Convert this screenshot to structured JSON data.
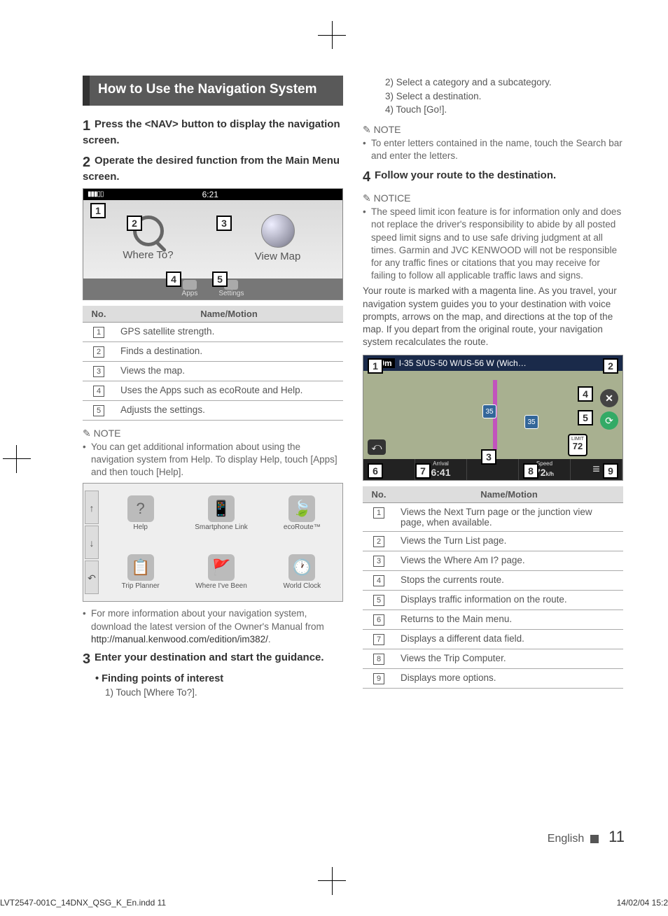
{
  "heading": "How to Use the Navigation System",
  "step1": {
    "num": "1",
    "text": "Press the <NAV> button to display the navigation screen."
  },
  "step2": {
    "num": "2",
    "text": "Operate the desired function from the Main Menu screen."
  },
  "mainMenu": {
    "time": "6:21",
    "whereTo": "Where To?",
    "viewMap": "View Map",
    "apps": "Apps",
    "settings": "Settings"
  },
  "table1": {
    "h_no": "No.",
    "h_nm": "Name/Motion",
    "rows": [
      {
        "n": "1",
        "t": "GPS satellite strength."
      },
      {
        "n": "2",
        "t": "Finds a destination."
      },
      {
        "n": "3",
        "t": "Views the map."
      },
      {
        "n": "4",
        "t": "Uses the Apps such as ecoRoute and Help."
      },
      {
        "n": "5",
        "t": "Adjusts the settings."
      }
    ]
  },
  "noteLabel": "NOTE",
  "noticeLabel": "NOTICE",
  "note1_a": "You can get additional information about using the navigation system from Help. To display Help, touch [Apps] and then touch [Help].",
  "appsGrid": {
    "items": [
      {
        "label": "Help"
      },
      {
        "label": "Smartphone Link"
      },
      {
        "label": "ecoRoute™"
      },
      {
        "label": "Trip Planner"
      },
      {
        "label": "Where I've Been"
      },
      {
        "label": "World Clock"
      }
    ]
  },
  "note1_b_pre": "For more information about your navigation system, download the latest version of the Owner's Manual from ",
  "note1_b_link": "http://manual.kenwood.com/edition/im382/",
  "note1_b_post": ".",
  "step3": {
    "num": "3",
    "text": "Enter your destination and start the guidance."
  },
  "poi": {
    "head": "Finding points of interest",
    "items": [
      "1)  Touch [Where To?].",
      "2)  Select a category and a subcategory.",
      "3)  Select a destination.",
      "4)  Touch [Go!]."
    ]
  },
  "note2": "To enter letters contained in the name, touch the Search bar and enter the letters.",
  "step4": {
    "num": "4",
    "text": "Follow your route to the destination."
  },
  "notice1": "The speed limit icon feature is for information only and does not replace the driver's responsibility to abide by all posted speed limit signs and to use safe driving judgment at all times. Garmin and JVC KENWOOD will not be responsible for any traffic fines or citations that you may receive for failing to follow all applicable traffic laws and signs.",
  "routePara": "Your route is marked with a magenta line. As you travel, your navigation system guides you to your destination with voice prompts, arrows on the map, and directions at the top of the map. If you depart from the original route, your navigation system recalculates the route.",
  "routeShot": {
    "dist": "500m",
    "road": "I-35 S/US-50 W/US-56 W (Wich…",
    "arrivalLabel": "Arrival",
    "arrival": "6:41",
    "speedLabel": "Speed",
    "speed": "72",
    "speedUnit": "k/h",
    "limitLabel": "LIMIT",
    "limit": "72",
    "sign1": "35",
    "sign2": "35"
  },
  "table2": {
    "h_no": "No.",
    "h_nm": "Name/Motion",
    "rows": [
      {
        "n": "1",
        "t": "Views the Next Turn page or the junction view page, when available."
      },
      {
        "n": "2",
        "t": "Views the Turn List page."
      },
      {
        "n": "3",
        "t": "Views the Where Am I? page."
      },
      {
        "n": "4",
        "t": "Stops the currents route."
      },
      {
        "n": "5",
        "t": "Displays traffic information on the route."
      },
      {
        "n": "6",
        "t": "Returns to the Main menu."
      },
      {
        "n": "7",
        "t": "Displays a different data field."
      },
      {
        "n": "8",
        "t": "Views the Trip Computer."
      },
      {
        "n": "9",
        "t": "Displays more options."
      }
    ]
  },
  "footer": {
    "lang": "English",
    "page": "11"
  },
  "print": {
    "left": "LVT2547-001C_14DNX_QSG_K_En.indd   11",
    "right": "14/02/04   15:2"
  }
}
